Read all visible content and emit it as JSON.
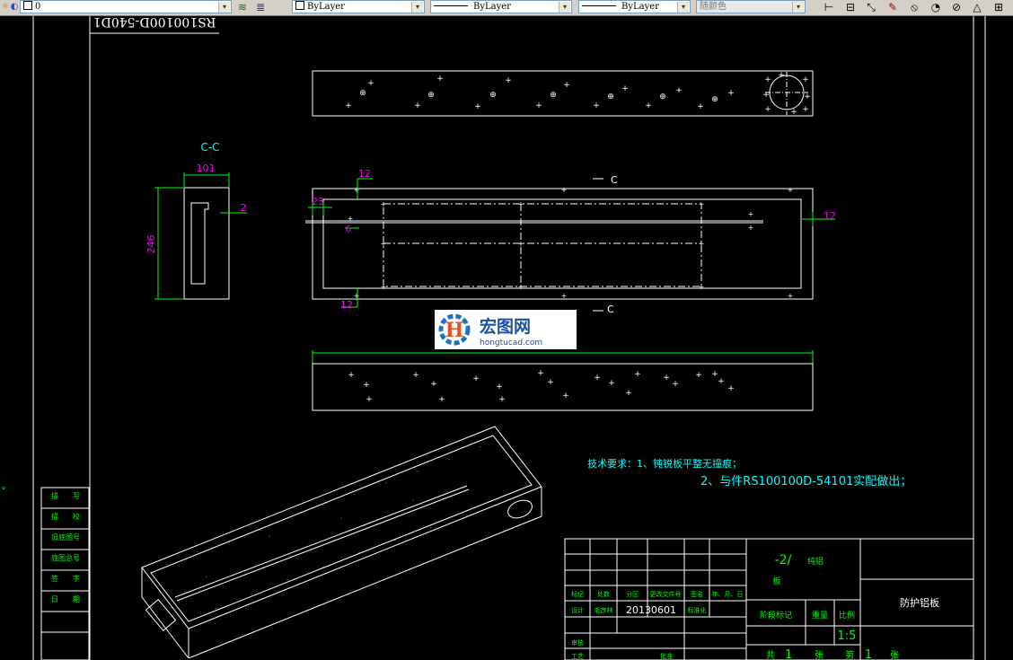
{
  "toolbar": {
    "layer_value": "0",
    "color_value": "ByLayer",
    "linetype_value": "ByLayer",
    "lineweight_value": "ByLayer",
    "plotstyle_value": "随颜色",
    "dropdown_glyph": "▾",
    "accent_color": "#000080"
  },
  "drawing": {
    "title_block_mirrored": "RS100100D-540D1",
    "section_label": "C-C",
    "section_marker_top": "C",
    "section_marker_bottom": "C",
    "dim_101": "101",
    "dim_246": "246",
    "dim_2": "2",
    "dim_12_top": "12",
    "dim_23": "23",
    "dim_6": "6",
    "dim_12_right": "12",
    "dim_12_bottom": "12",
    "tech_req_line1": "技术要求：1、钝锐板平整无撞痕；",
    "tech_req_line2": "2、与件RS100100D-54101实配做出；"
  },
  "left_table": [
    "描　　写",
    "描　　校",
    "旧底图号",
    "底图总号",
    "签　　字",
    "日　　期"
  ],
  "title_block": {
    "part_name_frag": "-2/",
    "part_name_suffix": "纯铝",
    "part_name_row2": "板",
    "drawing_name": "防护铝板",
    "col_headers": [
      "标记",
      "处数",
      "分区",
      "更改文件号",
      "签名",
      "年、月、日"
    ],
    "row_design_label": "设计",
    "designer": "毛彦林",
    "design_date": "20130601",
    "std_label": "标准化",
    "row_check": "审核",
    "row_craft": "工艺",
    "approve_label": "批准",
    "stage_mark": "阶段标记",
    "weight": "重量",
    "scale_label": "比例",
    "scale_value": "1:5",
    "sheets_prefix": "共",
    "sheets_total": "1",
    "sheets_mid": "张",
    "sheet_label": "第",
    "sheet_no": "1",
    "sheets_suffix": "张"
  },
  "watermark": {
    "brand": "宏图网",
    "domain": "hongtucad.com"
  }
}
